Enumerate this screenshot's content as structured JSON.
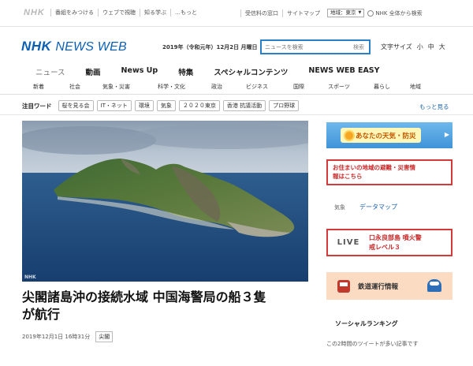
{
  "topbar": {
    "logo": "NHK",
    "links": [
      "番組をみつける",
      "ウェブで視聴",
      "知る学ぶ",
      "…もっと"
    ],
    "right_links": [
      "受信料の窓口",
      "サイトマップ"
    ],
    "region": "地域：東京",
    "global": "NHK 全体から検索"
  },
  "header": {
    "logo_nhk": "NHK",
    "logo_news": "NEWS WEB",
    "date": "2019年（令和元年）12月2日 月曜日",
    "search_placeholder": "ニュースを検索",
    "search_button": "検索",
    "fontsize_label": "文字サイズ",
    "fontsize_options": [
      "小",
      "中",
      "大"
    ]
  },
  "nav": {
    "primary": [
      "ニュース",
      "動画",
      "News Up",
      "特集",
      "スペシャルコンテンツ",
      "NEWS WEB EASY"
    ],
    "secondary": [
      "新着",
      "社会",
      "気象・災害",
      "科学・文化",
      "政治",
      "ビジネス",
      "国際",
      "スポーツ",
      "暮らし",
      "地域"
    ]
  },
  "tags": {
    "title": "注目ワード",
    "items": [
      "桜を見る会",
      "IT・ネット",
      "環境",
      "気象",
      "２０２０東京",
      "香港 抗議活動",
      "プロ野球"
    ],
    "more": "もっと見る"
  },
  "article": {
    "watermark": "NHK",
    "headline_1": "尖閣諸島沖の接続水域 中国海警局の船３隻",
    "headline_2": "が航行",
    "datetime": "2019年12月1日 16時31分",
    "category": "尖閣"
  },
  "sidebar": {
    "weather": "あなたの天気・防災",
    "disaster_1": "お住まいの地域の避難・災害情",
    "disaster_2": "報はこちら",
    "data_label": "気象",
    "data_link": "データマップ",
    "live_label": "LIVE",
    "live_1": "口永良部島 噴火警",
    "live_2": "戒レベル３",
    "train": "鉄道運行情報",
    "social_title": "ソーシャルランキング",
    "social_sub": "この2時間のツイートが多い記事です"
  },
  "colors": {
    "brand": "#0a5fb5",
    "alert": "#d43a3a",
    "link": "#1a63b0"
  }
}
